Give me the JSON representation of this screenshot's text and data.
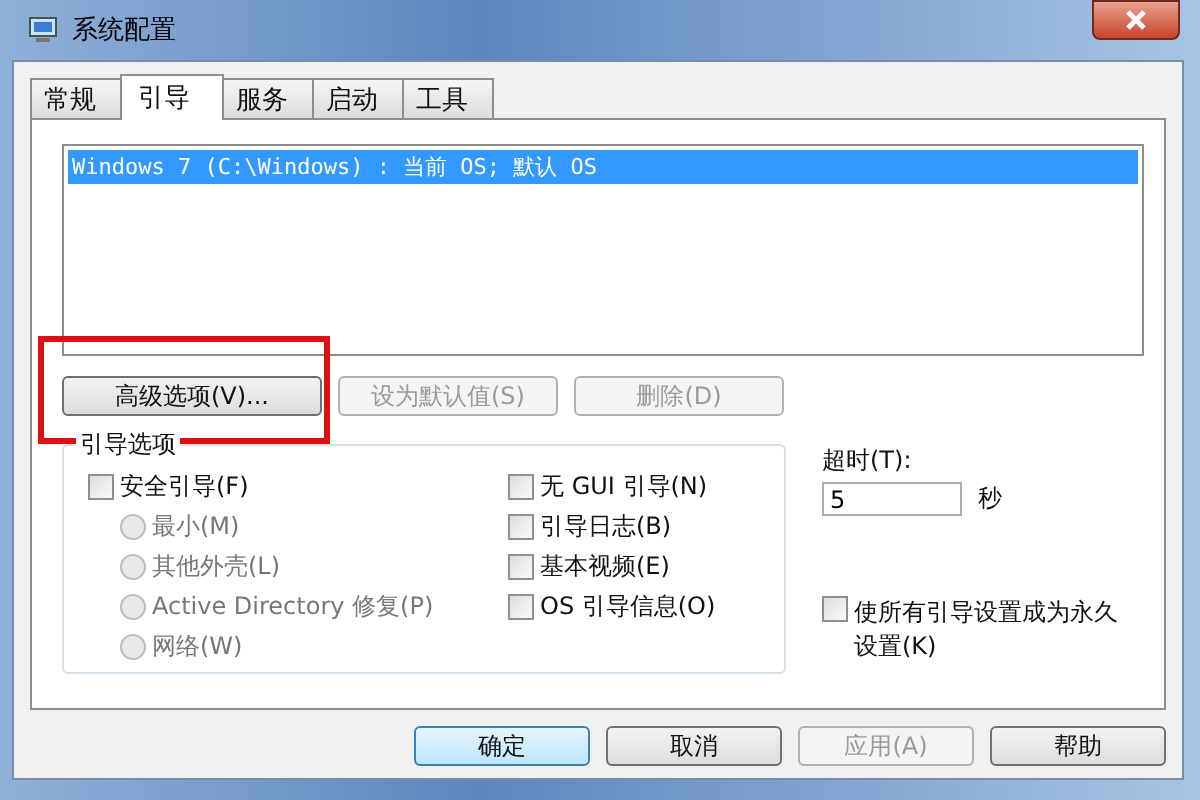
{
  "window": {
    "title": "系统配置"
  },
  "tabs": [
    {
      "label": "常规",
      "selected": false
    },
    {
      "label": "引导",
      "selected": true
    },
    {
      "label": "服务",
      "selected": false
    },
    {
      "label": "启动",
      "selected": false
    },
    {
      "label": "工具",
      "selected": false
    }
  ],
  "boot_list": {
    "items": [
      {
        "label": "Windows 7 (C:\\Windows) : 当前 OS; 默认 OS",
        "selected": true
      }
    ]
  },
  "boot_buttons": [
    {
      "label": "高级选项(V)...",
      "disabled": false,
      "highlighted": true
    },
    {
      "label": "设为默认值(S)",
      "disabled": true,
      "highlighted": false
    },
    {
      "label": "删除(D)",
      "disabled": true,
      "highlighted": false
    }
  ],
  "boot_options": {
    "title": "引导选项",
    "left": [
      {
        "kind": "checkbox",
        "label": "安全引导(F)",
        "checked": false,
        "disabled": false
      },
      {
        "kind": "radio",
        "label": "最小(M)",
        "selected": false,
        "disabled": true
      },
      {
        "kind": "radio",
        "label": "其他外壳(L)",
        "selected": false,
        "disabled": true
      },
      {
        "kind": "radio",
        "label": "Active Directory 修复(P)",
        "selected": false,
        "disabled": true
      },
      {
        "kind": "radio",
        "label": "网络(W)",
        "selected": false,
        "disabled": true
      }
    ],
    "right": [
      {
        "kind": "checkbox",
        "label": "无 GUI 引导(N)",
        "checked": false,
        "disabled": false
      },
      {
        "kind": "checkbox",
        "label": "引导日志(B)",
        "checked": false,
        "disabled": false
      },
      {
        "kind": "checkbox",
        "label": "基本视频(E)",
        "checked": false,
        "disabled": false
      },
      {
        "kind": "checkbox",
        "label": "OS 引导信息(O)",
        "checked": false,
        "disabled": false
      }
    ]
  },
  "timeout": {
    "label": "超时(T):",
    "value": "5",
    "unit": "秒"
  },
  "permanent": {
    "label": "使所有引导设置成为永久设置(K)",
    "checked": false
  },
  "dialog_buttons": [
    {
      "label": "确定",
      "disabled": false,
      "default": true
    },
    {
      "label": "取消",
      "disabled": false,
      "default": false
    },
    {
      "label": "应用(A)",
      "disabled": true,
      "default": false
    },
    {
      "label": "帮助",
      "disabled": false,
      "default": false
    }
  ]
}
